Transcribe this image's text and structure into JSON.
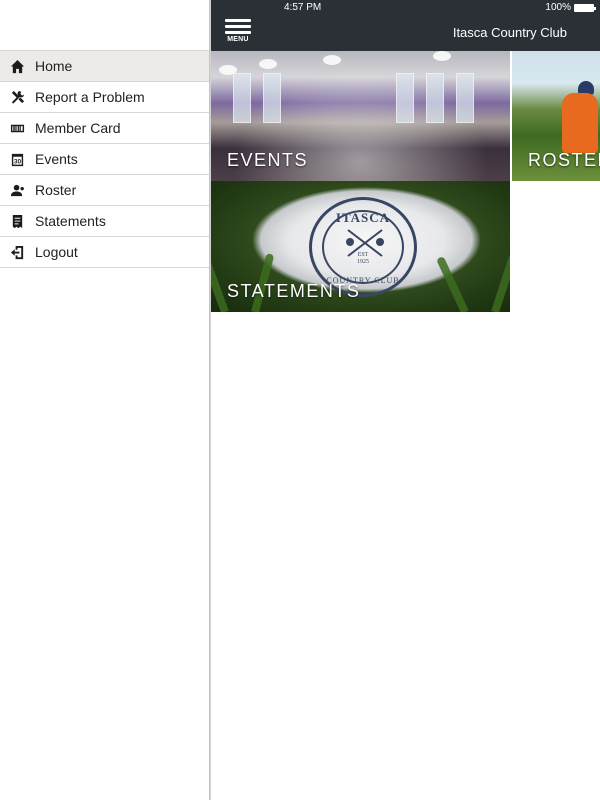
{
  "status": {
    "time": "4:57 PM",
    "battery": "100%"
  },
  "header": {
    "menu_label": "MENU",
    "title": "Itasca Country Club"
  },
  "sidebar": {
    "items": [
      {
        "label": "Home",
        "icon": "home-icon",
        "active": true
      },
      {
        "label": "Report a Problem",
        "icon": "tools-icon",
        "active": false
      },
      {
        "label": "Member Card",
        "icon": "card-icon",
        "active": false
      },
      {
        "label": "Events",
        "icon": "calendar-icon",
        "active": false
      },
      {
        "label": "Roster",
        "icon": "person-icon",
        "active": false
      },
      {
        "label": "Statements",
        "icon": "statement-icon",
        "active": false
      },
      {
        "label": "Logout",
        "icon": "logout-icon",
        "active": false
      }
    ],
    "calendar_day": "30"
  },
  "tiles": {
    "events": "EVENTS",
    "roster": "ROSTER",
    "statements": "STATEMENTS"
  },
  "emblem": {
    "name": "ITASCA",
    "est": "EST",
    "year": "1925",
    "subtitle": "COUNTRY CLUB"
  },
  "colors": {
    "header_bg": "#2b3036",
    "active_item_bg": "#ecebe8",
    "divider": "#d6d6d6"
  }
}
